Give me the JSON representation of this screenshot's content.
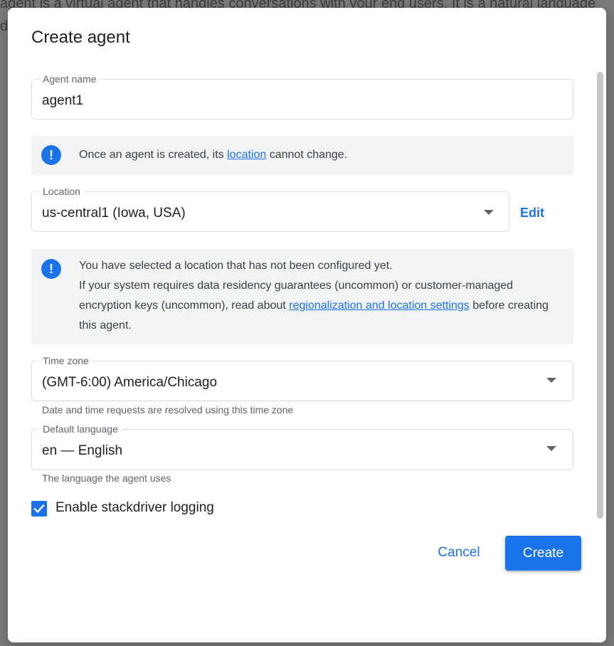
{
  "background": {
    "line1": "agent is a virtual agent that handles conversations with your end users. It is a natural language",
    "line2": "d"
  },
  "dialog": {
    "title": "Create agent",
    "agent_name": {
      "label": "Agent name",
      "value": "agent1"
    },
    "notice_location": {
      "icon": "info-icon",
      "text_before": "Once an agent is created, its ",
      "link": "location",
      "text_after": " cannot change."
    },
    "location": {
      "label": "Location",
      "value": "us-central1 (Iowa, USA)",
      "edit_label": "Edit"
    },
    "notice_config": {
      "icon": "info-icon",
      "line1": "You have selected a location that has not been configured yet.",
      "line2_before": "If your system requires data residency guarantees (uncommon) or customer-managed encryption keys (uncommon), read about ",
      "link": "regionalization and location settings",
      "line2_after": " before creating this agent."
    },
    "time_zone": {
      "label": "Time zone",
      "value": "(GMT-6:00) America/Chicago",
      "hint": "Date and time requests are resolved using this time zone"
    },
    "default_language": {
      "label": "Default language",
      "value": "en — English",
      "hint": "The language the agent uses"
    },
    "logging": {
      "label": "Enable stackdriver logging",
      "checked": true
    },
    "actions": {
      "cancel": "Cancel",
      "create": "Create"
    }
  },
  "colors": {
    "accent": "#1a73e8",
    "notice_bg": "#f1f3f4",
    "border": "#dadce0"
  }
}
